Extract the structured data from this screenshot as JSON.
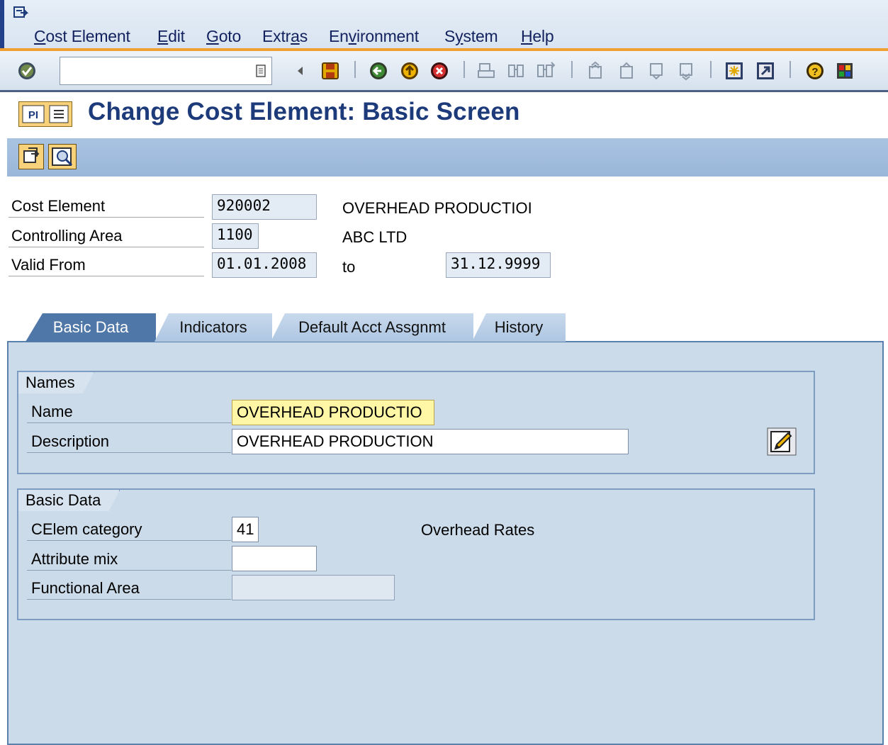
{
  "menu": {
    "items": [
      "Cost Element",
      "Edit",
      "Goto",
      "Extras",
      "Environment",
      "System",
      "Help"
    ],
    "underlined": [
      "C",
      "E",
      "G",
      "a",
      "v",
      "y",
      "H"
    ]
  },
  "toolbar": {
    "command_field": "",
    "icons": [
      "enter-icon",
      "save-icon",
      "back-icon",
      "exit-icon",
      "cancel-icon",
      "print-icon",
      "find-icon",
      "find-next-icon",
      "first-page-icon",
      "previous-page-icon",
      "next-page-icon",
      "last-page-icon",
      "create-session-icon",
      "shortcut-icon",
      "help-icon",
      "customize-layout-icon"
    ]
  },
  "title": "Change Cost Element: Basic Screen",
  "header": {
    "cost_element_label": "Cost Element",
    "cost_element_value": "920002",
    "cost_element_text": "OVERHEAD PRODUCTIOI",
    "controlling_area_label": "Controlling Area",
    "controlling_area_value": "1100",
    "controlling_area_text": "ABC LTD",
    "valid_from_label": "Valid From",
    "valid_from_value": "01.01.2008",
    "to_label": "to",
    "valid_to_value": "31.12.9999"
  },
  "tabs": [
    {
      "label": "Basic Data",
      "active": true
    },
    {
      "label": "Indicators",
      "active": false
    },
    {
      "label": "Default Acct Assgnmt",
      "active": false
    },
    {
      "label": "History",
      "active": false
    }
  ],
  "names_group": {
    "title": "Names",
    "name_label": "Name",
    "name_value": "OVERHEAD PRODUCTIO",
    "description_label": "Description",
    "description_value": "OVERHEAD PRODUCTION"
  },
  "basic_data_group": {
    "title": "Basic Data",
    "category_label": "CElem category",
    "category_value": "41",
    "category_text": "Overhead Rates",
    "attribute_mix_label": "Attribute mix",
    "attribute_mix_value": "",
    "functional_area_label": "Functional Area",
    "functional_area_value": ""
  },
  "colors": {
    "title": "#1d3a7a",
    "menu_accent": "#f0a032",
    "tab_active": "#4f77a8",
    "panel": "#cbdbe9",
    "focus_field": "#fff6a6"
  }
}
